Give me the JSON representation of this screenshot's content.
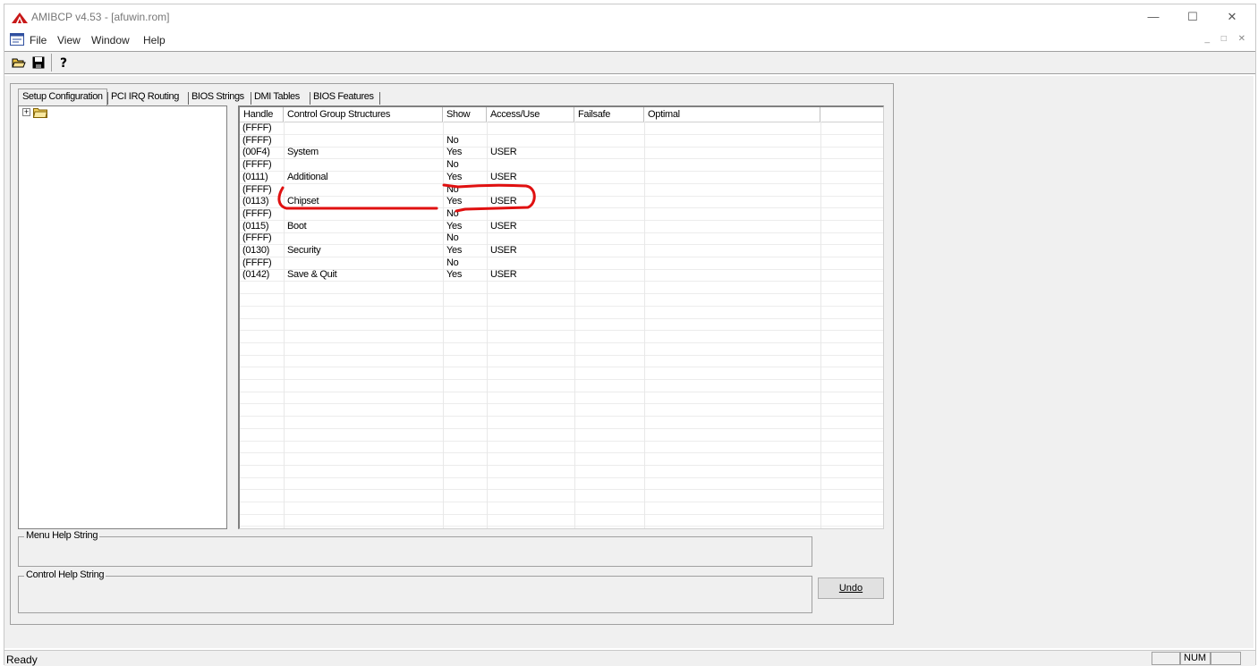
{
  "window": {
    "title": "AMIBCP v4.53 - [afuwin.rom]"
  },
  "menu": [
    "File",
    "View",
    "Window",
    "Help"
  ],
  "toolbar": {
    "buttons": [
      "open-icon",
      "save-icon",
      "help-icon"
    ]
  },
  "tabs": [
    "Setup Configuration",
    "PCI IRQ Routing",
    "BIOS Strings",
    "DMI Tables",
    "BIOS Features"
  ],
  "active_tab": "Setup Configuration",
  "grid": {
    "columns": [
      "Handle",
      "Control Group Structures",
      "Show",
      "Access/Use",
      "Failsafe",
      "Optimal"
    ],
    "rows": [
      [
        "(FFFF)",
        "",
        "",
        "",
        "",
        ""
      ],
      [
        "(FFFF)",
        "",
        "No",
        "",
        "",
        ""
      ],
      [
        "(00F4)",
        "System",
        "Yes",
        "USER",
        "",
        ""
      ],
      [
        "(FFFF)",
        "",
        "No",
        "",
        "",
        ""
      ],
      [
        "(0111)",
        "Additional",
        "Yes",
        "USER",
        "",
        ""
      ],
      [
        "(FFFF)",
        "",
        "No",
        "",
        "",
        ""
      ],
      [
        "(0113)",
        "Chipset",
        "Yes",
        "USER",
        "",
        ""
      ],
      [
        "(FFFF)",
        "",
        "No",
        "",
        "",
        ""
      ],
      [
        "(0115)",
        "Boot",
        "Yes",
        "USER",
        "",
        ""
      ],
      [
        "(FFFF)",
        "",
        "No",
        "",
        "",
        ""
      ],
      [
        "(0130)",
        "Security",
        "Yes",
        "USER",
        "",
        ""
      ],
      [
        "(FFFF)",
        "",
        "No",
        "",
        "",
        ""
      ],
      [
        "(0142)",
        "Save & Quit",
        "Yes",
        "USER",
        "",
        ""
      ]
    ]
  },
  "menu_help_label": "Menu Help String",
  "control_help_label": "Control Help String",
  "undo_label": "Undo",
  "status": {
    "text": "Ready",
    "num": "NUM"
  },
  "annotation_color": "#e01010"
}
